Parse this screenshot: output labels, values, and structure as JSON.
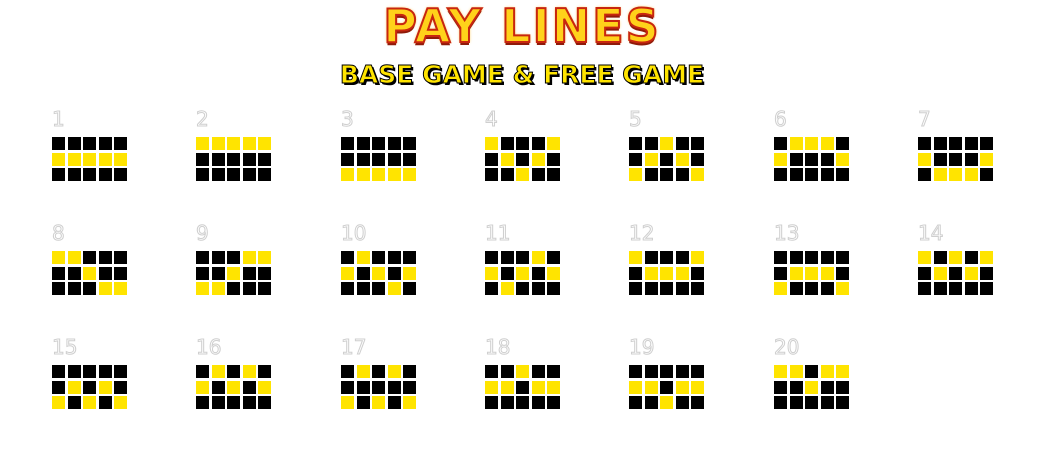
{
  "header": {
    "title": "PAY LINES",
    "subtitle": "BASE GAME & FREE GAME"
  },
  "colors": {
    "active": "#ffe400",
    "inactive": "#000000",
    "title_fill": "#ffd21a",
    "title_stroke": "#c8260f"
  },
  "paylines": [
    {
      "number": "1",
      "rows": [
        1,
        1,
        1,
        1,
        1
      ]
    },
    {
      "number": "2",
      "rows": [
        0,
        0,
        0,
        0,
        0
      ]
    },
    {
      "number": "3",
      "rows": [
        2,
        2,
        2,
        2,
        2
      ]
    },
    {
      "number": "4",
      "rows": [
        0,
        1,
        2,
        1,
        0
      ]
    },
    {
      "number": "5",
      "rows": [
        2,
        1,
        0,
        1,
        2
      ]
    },
    {
      "number": "6",
      "rows": [
        1,
        0,
        0,
        0,
        1
      ]
    },
    {
      "number": "7",
      "rows": [
        1,
        2,
        2,
        2,
        1
      ]
    },
    {
      "number": "8",
      "rows": [
        0,
        0,
        1,
        2,
        2
      ]
    },
    {
      "number": "9",
      "rows": [
        2,
        2,
        1,
        0,
        0
      ]
    },
    {
      "number": "10",
      "rows": [
        1,
        0,
        1,
        2,
        1
      ]
    },
    {
      "number": "11",
      "rows": [
        1,
        2,
        1,
        0,
        1
      ]
    },
    {
      "number": "12",
      "rows": [
        0,
        1,
        1,
        1,
        0
      ]
    },
    {
      "number": "13",
      "rows": [
        2,
        1,
        1,
        1,
        2
      ]
    },
    {
      "number": "14",
      "rows": [
        0,
        1,
        0,
        1,
        0
      ]
    },
    {
      "number": "15",
      "rows": [
        2,
        1,
        2,
        1,
        2
      ]
    },
    {
      "number": "16",
      "rows": [
        1,
        0,
        1,
        0,
        1
      ]
    },
    {
      "number": "17",
      "rows": [
        2,
        0,
        2,
        0,
        2
      ]
    },
    {
      "number": "18",
      "rows": [
        1,
        1,
        0,
        1,
        1
      ]
    },
    {
      "number": "19",
      "rows": [
        1,
        1,
        2,
        1,
        1
      ]
    },
    {
      "number": "20",
      "rows": [
        0,
        0,
        1,
        0,
        0
      ]
    }
  ]
}
